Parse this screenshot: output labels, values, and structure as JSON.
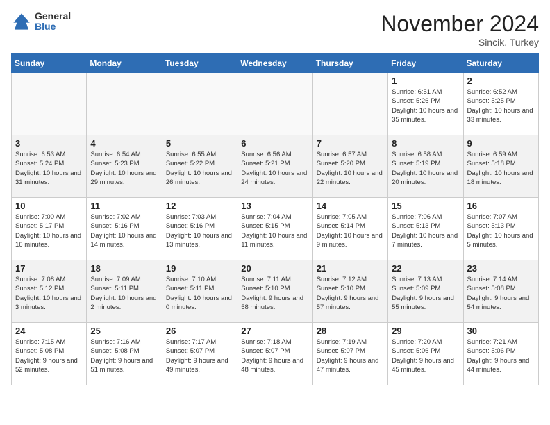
{
  "logo": {
    "general": "General",
    "blue": "Blue"
  },
  "title": "November 2024",
  "subtitle": "Sincik, Turkey",
  "days_header": [
    "Sunday",
    "Monday",
    "Tuesday",
    "Wednesday",
    "Thursday",
    "Friday",
    "Saturday"
  ],
  "weeks": [
    [
      {
        "day": "",
        "info": ""
      },
      {
        "day": "",
        "info": ""
      },
      {
        "day": "",
        "info": ""
      },
      {
        "day": "",
        "info": ""
      },
      {
        "day": "",
        "info": ""
      },
      {
        "day": "1",
        "info": "Sunrise: 6:51 AM\nSunset: 5:26 PM\nDaylight: 10 hours and 35 minutes."
      },
      {
        "day": "2",
        "info": "Sunrise: 6:52 AM\nSunset: 5:25 PM\nDaylight: 10 hours and 33 minutes."
      }
    ],
    [
      {
        "day": "3",
        "info": "Sunrise: 6:53 AM\nSunset: 5:24 PM\nDaylight: 10 hours and 31 minutes."
      },
      {
        "day": "4",
        "info": "Sunrise: 6:54 AM\nSunset: 5:23 PM\nDaylight: 10 hours and 29 minutes."
      },
      {
        "day": "5",
        "info": "Sunrise: 6:55 AM\nSunset: 5:22 PM\nDaylight: 10 hours and 26 minutes."
      },
      {
        "day": "6",
        "info": "Sunrise: 6:56 AM\nSunset: 5:21 PM\nDaylight: 10 hours and 24 minutes."
      },
      {
        "day": "7",
        "info": "Sunrise: 6:57 AM\nSunset: 5:20 PM\nDaylight: 10 hours and 22 minutes."
      },
      {
        "day": "8",
        "info": "Sunrise: 6:58 AM\nSunset: 5:19 PM\nDaylight: 10 hours and 20 minutes."
      },
      {
        "day": "9",
        "info": "Sunrise: 6:59 AM\nSunset: 5:18 PM\nDaylight: 10 hours and 18 minutes."
      }
    ],
    [
      {
        "day": "10",
        "info": "Sunrise: 7:00 AM\nSunset: 5:17 PM\nDaylight: 10 hours and 16 minutes."
      },
      {
        "day": "11",
        "info": "Sunrise: 7:02 AM\nSunset: 5:16 PM\nDaylight: 10 hours and 14 minutes."
      },
      {
        "day": "12",
        "info": "Sunrise: 7:03 AM\nSunset: 5:16 PM\nDaylight: 10 hours and 13 minutes."
      },
      {
        "day": "13",
        "info": "Sunrise: 7:04 AM\nSunset: 5:15 PM\nDaylight: 10 hours and 11 minutes."
      },
      {
        "day": "14",
        "info": "Sunrise: 7:05 AM\nSunset: 5:14 PM\nDaylight: 10 hours and 9 minutes."
      },
      {
        "day": "15",
        "info": "Sunrise: 7:06 AM\nSunset: 5:13 PM\nDaylight: 10 hours and 7 minutes."
      },
      {
        "day": "16",
        "info": "Sunrise: 7:07 AM\nSunset: 5:13 PM\nDaylight: 10 hours and 5 minutes."
      }
    ],
    [
      {
        "day": "17",
        "info": "Sunrise: 7:08 AM\nSunset: 5:12 PM\nDaylight: 10 hours and 3 minutes."
      },
      {
        "day": "18",
        "info": "Sunrise: 7:09 AM\nSunset: 5:11 PM\nDaylight: 10 hours and 2 minutes."
      },
      {
        "day": "19",
        "info": "Sunrise: 7:10 AM\nSunset: 5:11 PM\nDaylight: 10 hours and 0 minutes."
      },
      {
        "day": "20",
        "info": "Sunrise: 7:11 AM\nSunset: 5:10 PM\nDaylight: 9 hours and 58 minutes."
      },
      {
        "day": "21",
        "info": "Sunrise: 7:12 AM\nSunset: 5:10 PM\nDaylight: 9 hours and 57 minutes."
      },
      {
        "day": "22",
        "info": "Sunrise: 7:13 AM\nSunset: 5:09 PM\nDaylight: 9 hours and 55 minutes."
      },
      {
        "day": "23",
        "info": "Sunrise: 7:14 AM\nSunset: 5:08 PM\nDaylight: 9 hours and 54 minutes."
      }
    ],
    [
      {
        "day": "24",
        "info": "Sunrise: 7:15 AM\nSunset: 5:08 PM\nDaylight: 9 hours and 52 minutes."
      },
      {
        "day": "25",
        "info": "Sunrise: 7:16 AM\nSunset: 5:08 PM\nDaylight: 9 hours and 51 minutes."
      },
      {
        "day": "26",
        "info": "Sunrise: 7:17 AM\nSunset: 5:07 PM\nDaylight: 9 hours and 49 minutes."
      },
      {
        "day": "27",
        "info": "Sunrise: 7:18 AM\nSunset: 5:07 PM\nDaylight: 9 hours and 48 minutes."
      },
      {
        "day": "28",
        "info": "Sunrise: 7:19 AM\nSunset: 5:07 PM\nDaylight: 9 hours and 47 minutes."
      },
      {
        "day": "29",
        "info": "Sunrise: 7:20 AM\nSunset: 5:06 PM\nDaylight: 9 hours and 45 minutes."
      },
      {
        "day": "30",
        "info": "Sunrise: 7:21 AM\nSunset: 5:06 PM\nDaylight: 9 hours and 44 minutes."
      }
    ]
  ]
}
